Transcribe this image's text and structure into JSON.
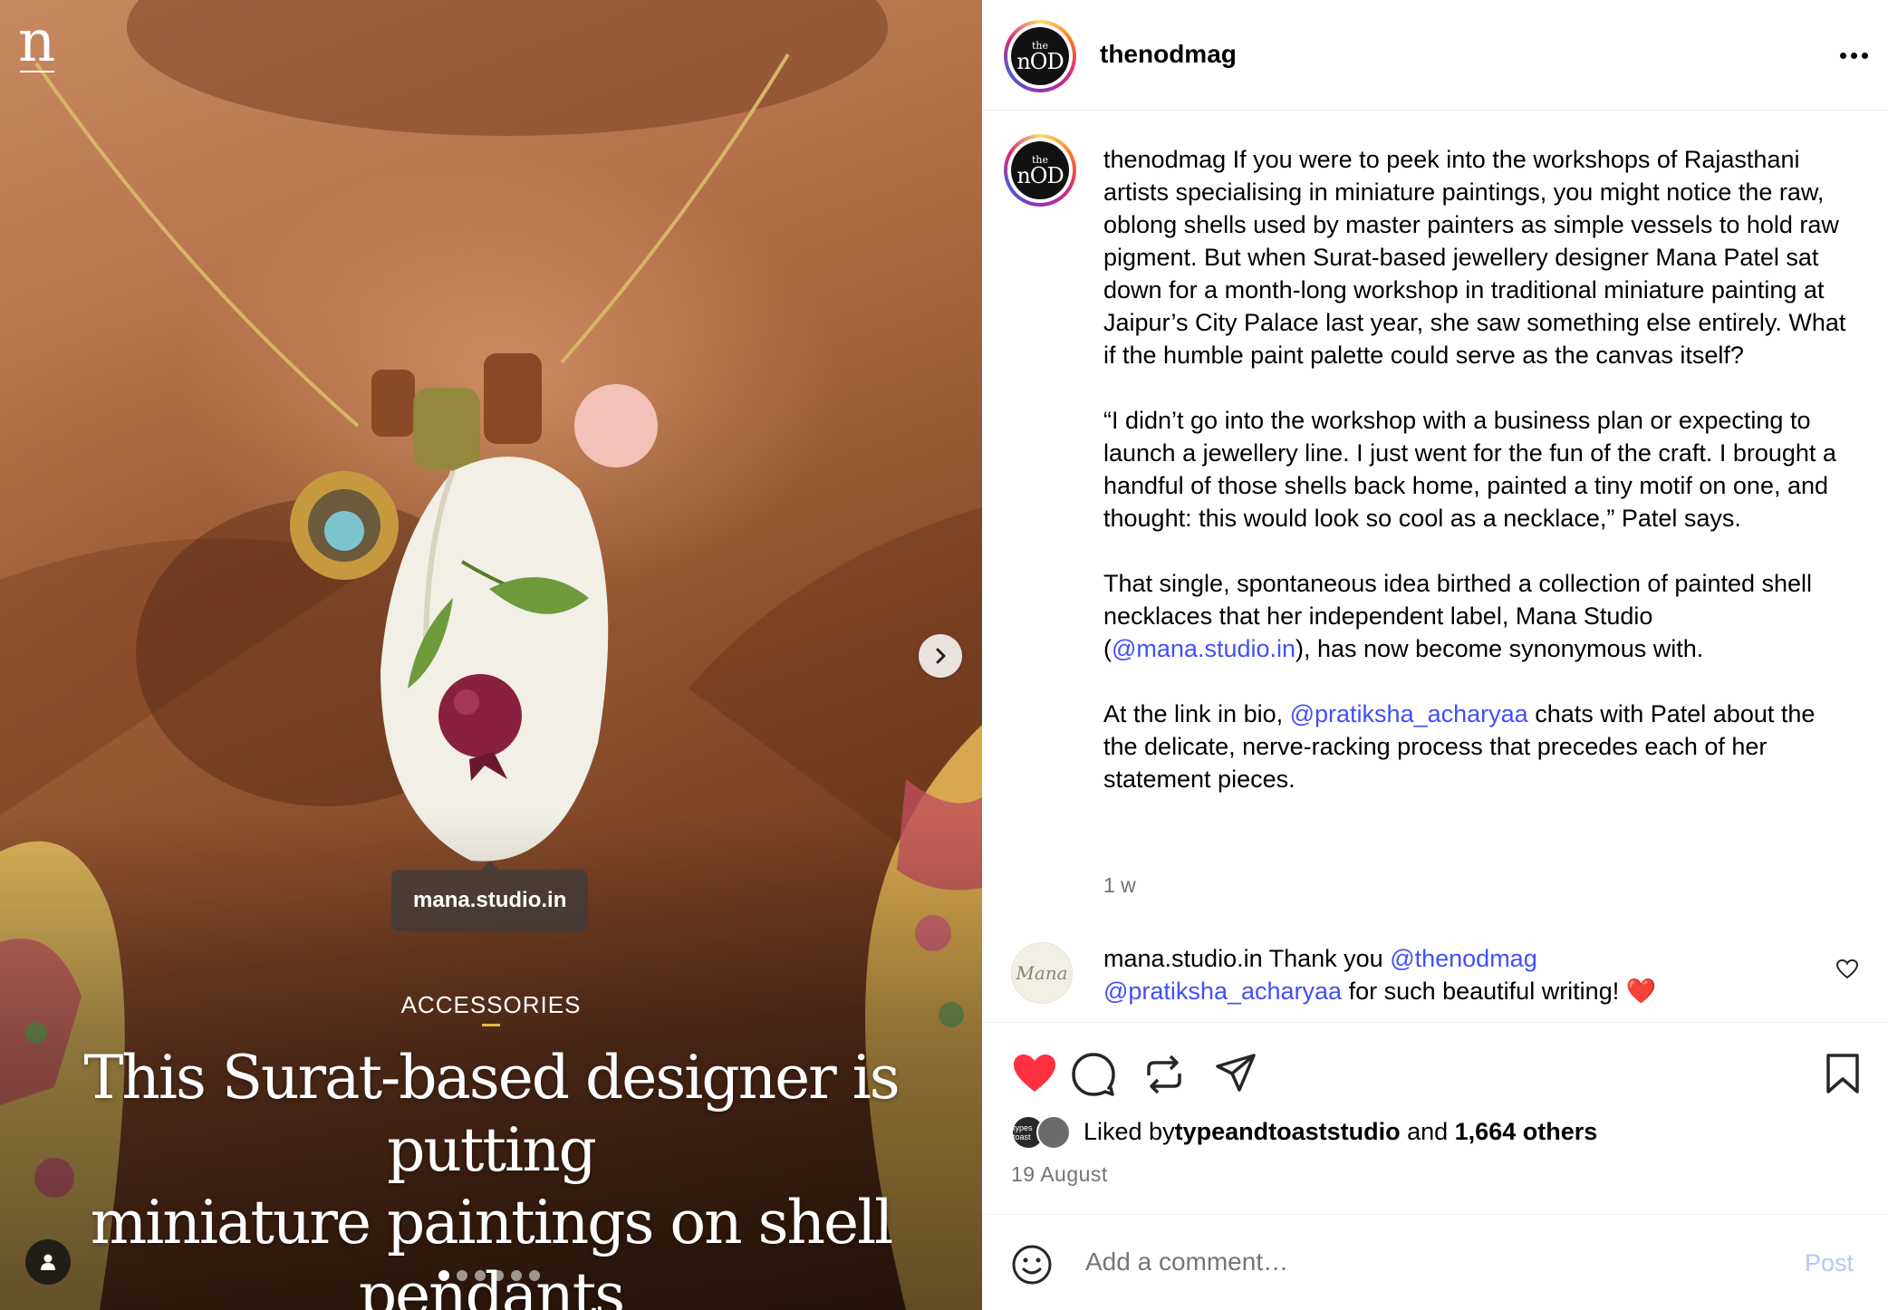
{
  "media": {
    "brand_logo": "n",
    "tag_label": "mana.studio.in",
    "category": "ACCESSORIES",
    "headline_line1": "This Surat-based designer is putting",
    "headline_line2": "miniature paintings on shell pendants",
    "carousel": {
      "total": 6,
      "active_index": 0
    },
    "icons": {
      "next": "chevron-right-icon",
      "tagged_user": "person-icon"
    }
  },
  "header": {
    "avatar_top": "the",
    "avatar_main": "nOD",
    "username": "thenodmag",
    "more_icon": "more-horizontal-icon"
  },
  "caption": {
    "username": "thenodmag",
    "p1": "If you were to peek into the workshops of Rajasthani artists specialising in miniature paintings, you might notice the raw, oblong shells used by master painters as simple vessels to hold raw pigment. But when Surat-based jewellery designer Mana Patel sat down for a month-long workshop in traditional miniature painting at Jaipur’s City Palace last year, she saw something else entirely. What if the humble paint palette could serve as the canvas itself?",
    "p2": "“I didn’t go into the workshop with a business plan or expecting to launch a jewellery line. I just went for the fun of the craft. I brought a handful of those shells back home, painted a tiny motif on one, and thought: this would look so cool as a necklace,” Patel says.",
    "p3_a": "That single, spontaneous idea birthed a collection of painted shell necklaces that her independent label, Mana Studio (",
    "p3_mention": "@mana.studio.in",
    "p3_b": "), has now become synonymous with.",
    "p4_a": "At the link in bio, ",
    "p4_mention": "@pratiksha_acharyaa",
    "p4_b": " chats with Patel about the the delicate, nerve-racking process that precedes each of her statement pieces.",
    "time_ago": "1 w"
  },
  "comment": {
    "avatar_text": "Mana",
    "username": "mana.studio.in",
    "text_a": "Thank you ",
    "mention1": "@thenodmag",
    "mention2": "@pratiksha_acharyaa",
    "text_b": " for such beautiful writing! ",
    "emoji": "❤️",
    "like_icon": "heart-outline-icon"
  },
  "actions": {
    "icons": [
      "heart-filled-icon",
      "comment-icon",
      "repost-icon",
      "share-icon",
      "bookmark-icon"
    ],
    "liked": true,
    "like_color": "#ff3040",
    "likes_prefix": "Liked by ",
    "likes_user": "typeandtoaststudio",
    "likes_and": " and ",
    "likes_others": "1,664 others",
    "liker_avatar1_text": "types toast",
    "date": "19 August"
  },
  "comment_box": {
    "placeholder": "Add a comment…",
    "post_label": "Post",
    "emoji_icon": "smiley-icon"
  },
  "colors": {
    "mention": "#4150f7",
    "muted": "#737373",
    "post_disabled": "#b2c9f5",
    "category_rule": "#e6b84b"
  }
}
